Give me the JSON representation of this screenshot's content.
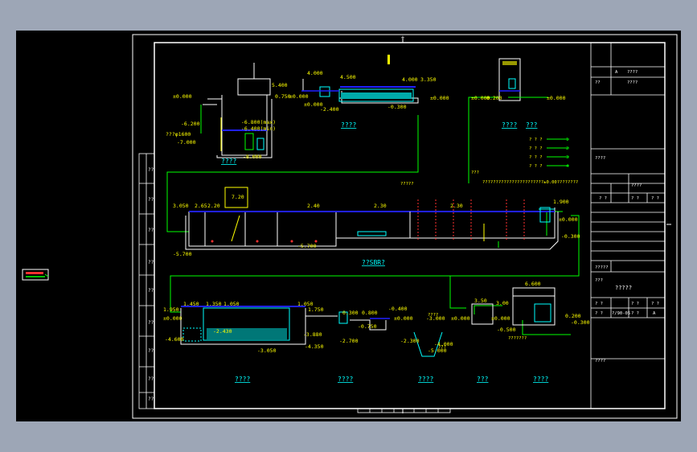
{
  "colors": {
    "background": "#9da6b6",
    "canvas": "#000000",
    "frame": "#ffffff",
    "pipe": "#00ff00",
    "water": "#00ffff",
    "level": "#2020ff",
    "dim": "#ffff00",
    "accent": "#ff3030"
  },
  "labels": {
    "l01": "4.000",
    "l02": "4.500",
    "l03": "4.000",
    "l04": "3.350",
    "l05": "5.400",
    "l06": "±0.000",
    "l07": "0.750",
    "l08": "±0.000",
    "l09": "±0.000",
    "l10": "-0.300",
    "l11": "-2.400",
    "l12": "±0.000",
    "l13": "±0.000",
    "l14": "0.200",
    "l15": "±0.000",
    "l16": "-6.800(max)",
    "l17": "-6.400(min)",
    "l18": "-6.200",
    "l19": "???φ1600",
    "l20": "-7.000",
    "l21": "-8.000",
    "l22": "3.050",
    "l23": "2.65",
    "l24": "2.20",
    "l25": "7.20",
    "l26": "2.40",
    "l27": "2.30",
    "l28": "2.30",
    "l29": "1.900",
    "l30": "±0.000",
    "l31": "-0.300",
    "l32": "-5.700",
    "l33": "-5.700",
    "l34": "6.600",
    "l35": "1.450",
    "l36": "1.350",
    "l37": "1.050",
    "l38": "1.050",
    "l39": "1.950",
    "l40": "±0.000",
    "l41": "1.750",
    "l42": "0.300",
    "l43": "0.800",
    "l44": "-0.400",
    "l45": "±0.000",
    "l46": "±0.000",
    "l47": "±0.000",
    "l48": "3.50",
    "l49": "3.00",
    "l50": "0.200",
    "l51": "-0.300",
    "l52": "-0.500",
    "l53": "-2.430",
    "l54": "-3.050",
    "l55": "-4.600",
    "l56": "-3.880",
    "l57": "-4.350",
    "l58": "-2.700",
    "l59": "-0.750",
    "l60": "-3.000",
    "l61": "-2.300",
    "l62": "-4.000",
    "l63": "-5.000"
  },
  "section_titles": {
    "t1": "????",
    "t2": "????",
    "t3": "????",
    "t4": "???",
    "t5": "??SBR?",
    "t6": "????",
    "t7": "????",
    "t8": "????",
    "t9": "???",
    "t10": "????"
  },
  "notes": {
    "n1": "???",
    "n2": "???????????????????????±0.00????????",
    "n3": "?????",
    "n4": "????",
    "n5": "???",
    "n6": "???????"
  },
  "legend": [
    {
      "mark": "? ? ?",
      "num": "1"
    },
    {
      "mark": "? ? ?",
      "num": "2"
    },
    {
      "mark": "? ? ?",
      "num": "3"
    },
    {
      "mark": "? ? ?",
      "num": "4"
    }
  ],
  "title_block": {
    "a": "A",
    "b": "????",
    "c": "????",
    "d": "??",
    "e": "????",
    "f": "????",
    "g": "?  ?",
    "h": "?  ?",
    "i": "?  ?",
    "j": "?????",
    "k": "?????",
    "l": "???",
    "m": "?  ?",
    "n": "?  ?",
    "o": "?  ?",
    "p": "?  ?",
    "q": "?/90-05",
    "r": "?  ?",
    "s": "A",
    "t": "????"
  }
}
